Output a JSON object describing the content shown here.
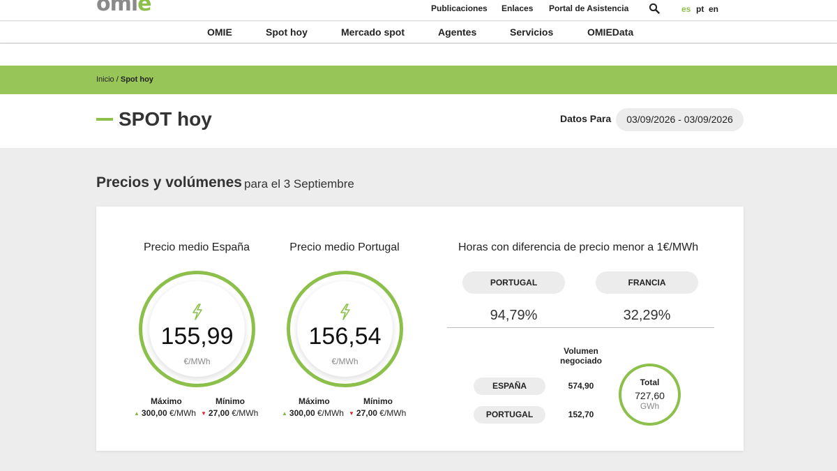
{
  "brand": {
    "logo_main": "omi",
    "logo_accent": "e",
    "accent_color": "#8cc04b",
    "band_color": "#97c557"
  },
  "utility_nav": {
    "publicaciones": "Publicaciones",
    "enlaces": "Enlaces",
    "portal": "Portal de Asistencia",
    "search_icon": "search-icon"
  },
  "languages": {
    "es": "es",
    "pt": "pt",
    "en": "en",
    "active": "es"
  },
  "main_nav": [
    {
      "label": "OMIE"
    },
    {
      "label": "Spot hoy"
    },
    {
      "label": "Mercado spot"
    },
    {
      "label": "Agentes"
    },
    {
      "label": "Servicios"
    },
    {
      "label": "OMIEData"
    }
  ],
  "breadcrumb": {
    "home": "Inicio",
    "separator": " / ",
    "current": "Spot hoy"
  },
  "page": {
    "title": "SPOT hoy",
    "date_label": "Datos Para",
    "date_range": "03/09/2026 - 03/09/2026"
  },
  "section": {
    "title": "Precios y volúmenes",
    "subtitle": "para el 3 Septiembre"
  },
  "prices": [
    {
      "heading": "Precio medio España",
      "value": "155,99",
      "unit": "€/MWh",
      "max_label": "Máximo",
      "max_value": "300,00",
      "min_label": "Mínimo",
      "min_value": "27,00",
      "mm_unit": "€/MWh"
    },
    {
      "heading": "Precio medio Portugal",
      "value": "156,54",
      "unit": "€/MWh",
      "max_label": "Máximo",
      "max_value": "300,00",
      "min_label": "Mínimo",
      "min_value": "27,00",
      "mm_unit": "€/MWh"
    }
  ],
  "hours": {
    "heading": "Horas con diferencia de precio menor a 1€/MWh",
    "countries": [
      {
        "name": "PORTUGAL",
        "pct": "94,79%"
      },
      {
        "name": "FRANCIA",
        "pct": "32,29%"
      }
    ]
  },
  "volume": {
    "heading_line1": "Volumen",
    "heading_line2": "negociado",
    "rows": [
      {
        "country": "ESPAÑA",
        "value": "574,90"
      },
      {
        "country": "PORTUGAL",
        "value": "152,70"
      }
    ],
    "total_label": "Total",
    "total_value": "727,60",
    "total_unit": "GWh"
  }
}
